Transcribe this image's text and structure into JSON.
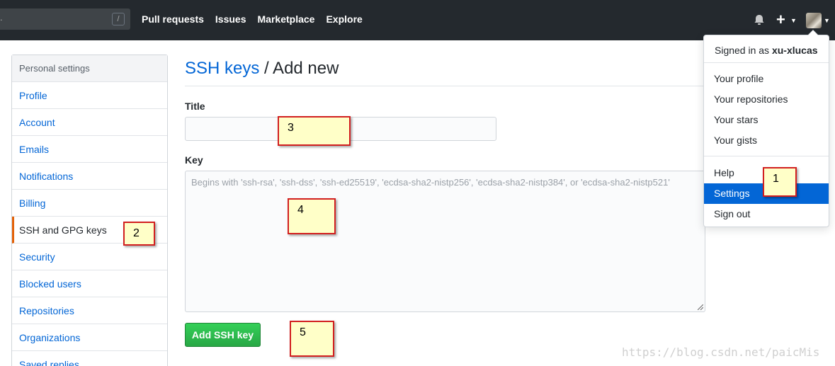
{
  "header": {
    "search_partial_text": ".",
    "search_shortcut": "/",
    "nav": [
      "Pull requests",
      "Issues",
      "Marketplace",
      "Explore"
    ],
    "icons": [
      "bell-icon",
      "plus-icon",
      "avatar"
    ],
    "bg_color": "#24292e"
  },
  "sidebar": {
    "header": "Personal settings",
    "items": [
      {
        "label": "Profile"
      },
      {
        "label": "Account"
      },
      {
        "label": "Emails"
      },
      {
        "label": "Notifications"
      },
      {
        "label": "Billing"
      },
      {
        "label": "SSH and GPG keys",
        "selected": true
      },
      {
        "label": "Security"
      },
      {
        "label": "Blocked users"
      },
      {
        "label": "Repositories"
      },
      {
        "label": "Organizations"
      },
      {
        "label": "Saved replies"
      }
    ]
  },
  "main": {
    "title_link": "SSH keys",
    "title_rest": " / Add new",
    "title_label": "Title",
    "key_label": "Key",
    "key_placeholder": "Begins with 'ssh-rsa', 'ssh-dss', 'ssh-ed25519', 'ecdsa-sha2-nistp256', 'ecdsa-sha2-nistp384', or 'ecdsa-sha2-nistp521'",
    "submit_label": "Add SSH key"
  },
  "dropdown": {
    "signed_in_prefix": "Signed in as ",
    "username": "xu-xlucas",
    "group1": [
      "Your profile",
      "Your repositories",
      "Your stars",
      "Your gists"
    ],
    "group2": [
      "Help",
      "Settings",
      "Sign out"
    ],
    "active_item": "Settings"
  },
  "annotations": [
    "1",
    "2",
    "3",
    "4",
    "5"
  ],
  "watermark": "https://blog.csdn.net/paicMis"
}
